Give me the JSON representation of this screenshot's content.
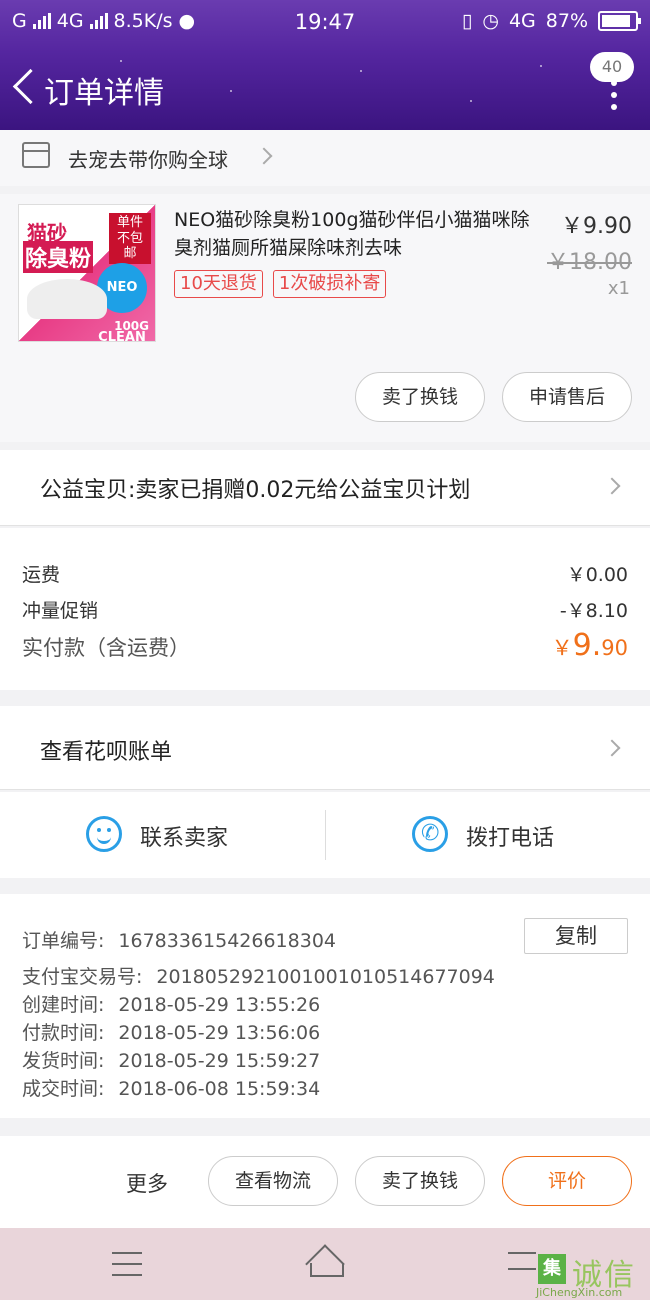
{
  "status_bar": {
    "carrier_1": "G",
    "carrier_2": "4G",
    "speed": "8.5K/s",
    "time": "19:47",
    "network_right": "4G",
    "battery": "87%"
  },
  "header": {
    "title": "订单详情",
    "message_badge": "40"
  },
  "shop": {
    "name": "去宠去带你购全球"
  },
  "product": {
    "name": "NEO猫砂除臭粉100g猫砂伴侣小猫猫咪除臭剂猫厕所猫屎除味剂去味",
    "price": "￥9.90",
    "original_price": "￥18.00",
    "quantity": "x1",
    "tags": [
      "10天退货",
      "1次破损补寄"
    ],
    "image_text": {
      "line1": "猫砂",
      "line2": "除臭粉",
      "promo": "单件不包邮",
      "brand": "NEO CLEAN",
      "weight": "100G"
    },
    "buttons": {
      "sell": "卖了换钱",
      "after_sale": "申请售后"
    }
  },
  "charity": {
    "text": "公益宝贝:卖家已捐赠0.02元给公益宝贝计划"
  },
  "fees": {
    "shipping_label": "运费",
    "shipping_value": "￥0.00",
    "promo_label": "冲量促销",
    "promo_value": "-￥8.10",
    "total_label": "实付款（含运费）",
    "total_currency": "￥",
    "total_integer": "9.",
    "total_decimal": "90"
  },
  "huabei": {
    "text": "查看花呗账单"
  },
  "contact": {
    "seller": "联系卖家",
    "call": "拨打电话"
  },
  "order_info": {
    "order_no_label": "订单编号:",
    "order_no": "167833615426618304",
    "copy_label": "复制",
    "alipay_label": "支付宝交易号:",
    "alipay_no": "2018052921001001010514677094",
    "created_label": "创建时间:",
    "created": "2018-05-29 13:55:26",
    "paid_label": "付款时间:",
    "paid": "2018-05-29 13:56:06",
    "shipped_label": "发货时间:",
    "shipped": "2018-05-29 15:59:27",
    "completed_label": "成交时间:",
    "completed": "2018-06-08 15:59:34"
  },
  "actions": {
    "more": "更多",
    "logistics": "查看物流",
    "sell": "卖了换钱",
    "review": "评价"
  },
  "watermark": {
    "logo": "集",
    "cn": "诚信",
    "en": "JiChengXin.com"
  },
  "colors": {
    "header_purple": "#5526a0",
    "accent_orange": "#f0701a",
    "tag_red": "#e84a4a",
    "icon_blue": "#2a9fe6"
  }
}
